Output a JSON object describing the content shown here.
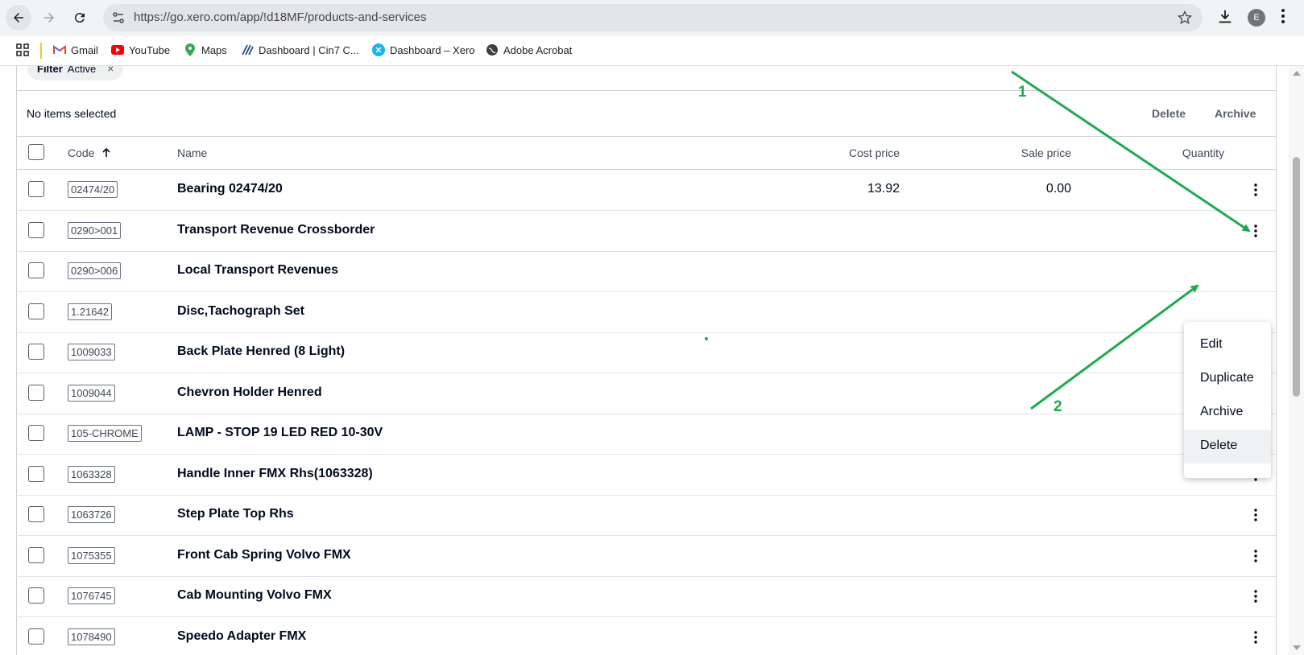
{
  "browser": {
    "url": "https://go.xero.com/app/!d18MF/products-and-services",
    "profile_initial": "E",
    "bookmarks": [
      {
        "label": "Gmail",
        "icon": "gmail-icon"
      },
      {
        "label": "YouTube",
        "icon": "youtube-icon"
      },
      {
        "label": "Maps",
        "icon": "maps-icon"
      },
      {
        "label": "Dashboard | Cin7 C...",
        "icon": "cin7-icon"
      },
      {
        "label": "Dashboard – Xero",
        "icon": "xero-icon"
      },
      {
        "label": "Adobe Acrobat",
        "icon": "globe-icon"
      }
    ]
  },
  "filter": {
    "key": "Filter",
    "value": "Active",
    "remove": "×"
  },
  "selection": {
    "status": "No items selected",
    "delete_label": "Delete",
    "archive_label": "Archive"
  },
  "table": {
    "headers": {
      "code": "Code",
      "name": "Name",
      "cost": "Cost price",
      "sale": "Sale price",
      "quantity": "Quantity"
    },
    "sort": {
      "column": "Code",
      "direction": "ascending"
    },
    "rows": [
      {
        "code": "02474/20",
        "name": "Bearing 02474/20",
        "cost": "13.92",
        "sale": "0.00"
      },
      {
        "code": "0290>001",
        "name": "Transport Revenue Crossborder",
        "cost": "",
        "sale": ""
      },
      {
        "code": "0290>006",
        "name": "Local Transport Revenues",
        "cost": "",
        "sale": ""
      },
      {
        "code": "1.21642",
        "name": "Disc,Tachograph Set",
        "cost": "",
        "sale": ""
      },
      {
        "code": "1009033",
        "name": "Back Plate Henred (8 Light)",
        "cost": "",
        "sale": ""
      },
      {
        "code": "1009044",
        "name": "Chevron Holder Henred",
        "cost": "",
        "sale": ""
      },
      {
        "code": "105-CHROME",
        "name": "LAMP - STOP 19 LED RED 10-30V",
        "cost": "",
        "sale": ""
      },
      {
        "code": "1063328",
        "name": "Handle Inner FMX Rhs(1063328)",
        "cost": "",
        "sale": ""
      },
      {
        "code": "1063726",
        "name": "Step Plate Top Rhs",
        "cost": "",
        "sale": ""
      },
      {
        "code": "1075355",
        "name": "Front Cab Spring Volvo FMX",
        "cost": "",
        "sale": ""
      },
      {
        "code": "1076745",
        "name": "Cab Mounting Volvo FMX",
        "cost": "",
        "sale": ""
      },
      {
        "code": "1078490",
        "name": "Speedo Adapter FMX",
        "cost": "",
        "sale": ""
      }
    ]
  },
  "row_menu": {
    "open_for_row": "Transport Revenue Crossborder",
    "items": [
      "Edit",
      "Duplicate",
      "Archive",
      "Delete"
    ],
    "highlighted": "Delete"
  },
  "annotations": {
    "color": "#1faa4b",
    "labels": [
      "1",
      "2"
    ]
  }
}
